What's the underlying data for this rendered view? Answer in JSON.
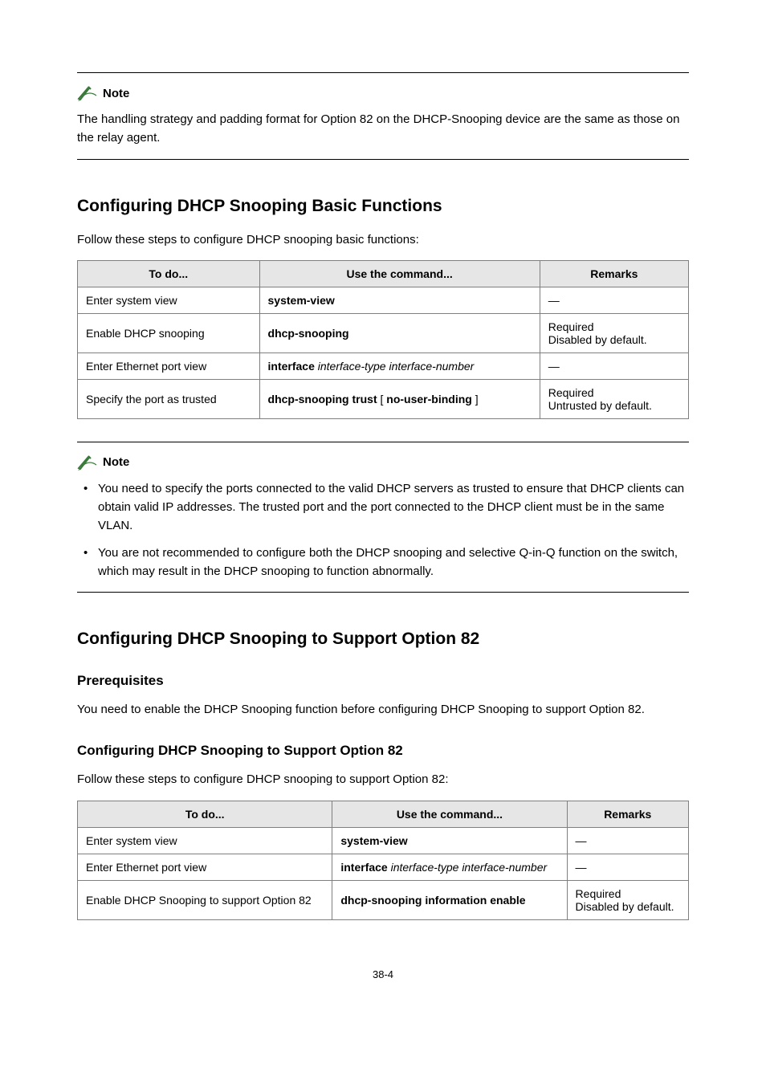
{
  "note1": {
    "label": "Note",
    "text": "The handling strategy and padding format for Option 82 on the DHCP-Snooping device are the same as those on the relay agent."
  },
  "section1": {
    "heading": "Configuring DHCP Snooping Basic Functions",
    "lead": "Follow these steps to configure DHCP snooping basic functions:",
    "head": {
      "c1": "To do...",
      "c2": "Use the command...",
      "c3": "Remarks"
    },
    "rows": [
      {
        "c1": "Enter system view",
        "c2": "system-view",
        "c3": "—"
      },
      {
        "c1": "Enable DHCP snooping",
        "c2": "dhcp-snooping",
        "c3": "Required\nDisabled by default."
      },
      {
        "c1": "Enter Ethernet port view",
        "c2_a": "interface",
        "c2_b": " interface-type interface-number",
        "c3": "—"
      },
      {
        "c1": "Specify the port as trusted",
        "c2_a": "dhcp-snooping trust",
        "c2_b": " [ ",
        "c2_c": "no-user-binding",
        "c2_d": " ]",
        "c3": "Required\nUntrusted by default."
      }
    ]
  },
  "note2": {
    "label": "Note",
    "bullet1": "You need to specify the ports connected to the valid DHCP servers as trusted to ensure that DHCP clients can obtain valid IP addresses. The trusted port and the port connected to the DHCP client must be in the same VLAN.",
    "bullet2": "You are not recommended to configure both the DHCP snooping and selective Q-in-Q function on the switch, which may result in the DHCP snooping to function abnormally."
  },
  "section2": {
    "heading": "Configuring DHCP Snooping to Support Option 82",
    "sub1": "Prerequisites",
    "pretext": "You need to enable the DHCP Snooping function before configuring DHCP Snooping to support Option 82.",
    "sub2": "Configuring DHCP Snooping to Support Option 82",
    "lead": "Follow these steps to configure DHCP snooping to support Option 82:",
    "head": {
      "c1": "To do...",
      "c2": "Use the command...",
      "c3": "Remarks"
    },
    "rows": [
      {
        "c1": "Enter system view",
        "c2": "system-view",
        "c3": "—"
      },
      {
        "c1": "Enter Ethernet port view",
        "c2_a": "interface",
        "c2_b": " interface-type interface-number",
        "c3": "—"
      },
      {
        "c1": "Enable DHCP Snooping to support Option 82",
        "c2_a": "dhcp-snooping information enable",
        "c3": "Required\nDisabled by default."
      }
    ]
  },
  "footer": "38-4"
}
